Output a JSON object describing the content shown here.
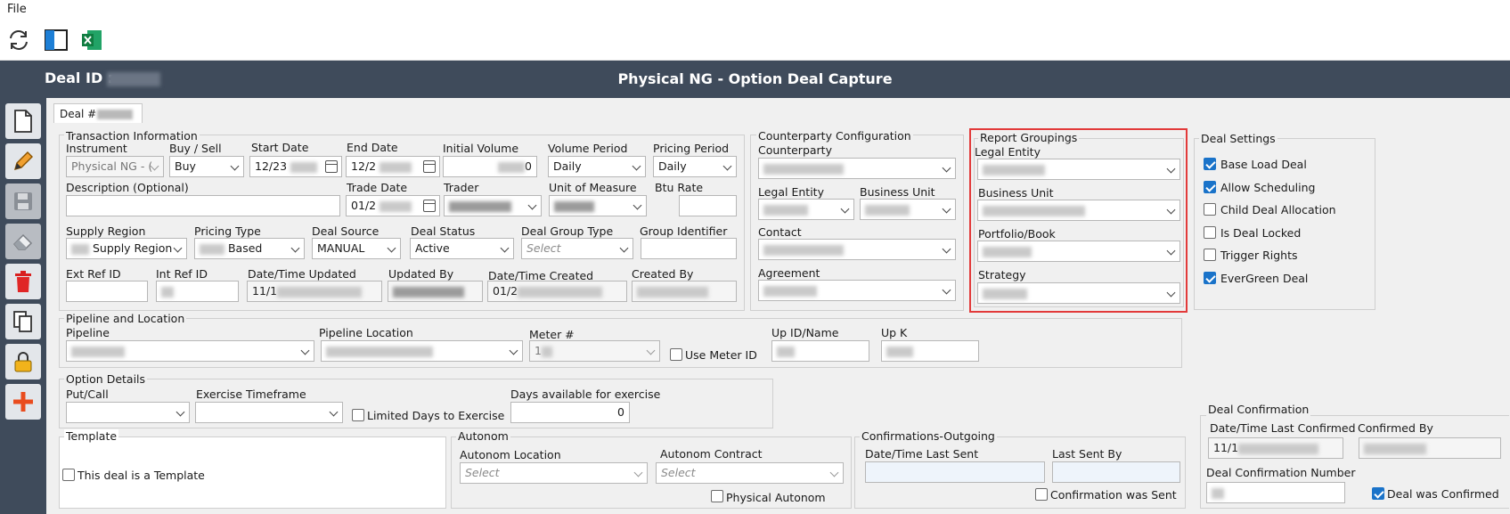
{
  "menu": {
    "file": "File"
  },
  "header": {
    "deal_id_label": "Deal ID :",
    "title": "Physical NG - Option Deal Capture"
  },
  "tab": {
    "label": "Deal #"
  },
  "transaction": {
    "title": "Transaction Information",
    "instrument_label": "Instrument",
    "instrument_value": "Physical NG - (",
    "buy_sell_label": "Buy / Sell",
    "buy_sell_value": "Buy",
    "start_date_label": "Start Date",
    "start_date_value": "12/23",
    "end_date_label": "End Date",
    "end_date_value": "12/2",
    "initial_volume_label": "Initial Volume",
    "initial_volume_value": "0",
    "volume_period_label": "Volume Period",
    "volume_period_value": "Daily",
    "pricing_period_label": "Pricing Period",
    "pricing_period_value": "Daily",
    "description_label": "Description (Optional)",
    "trade_date_label": "Trade Date",
    "trade_date_value": "01/2",
    "trader_label": "Trader",
    "unit_label": "Unit of Measure",
    "btu_label": "Btu Rate",
    "supply_region_label": "Supply Region",
    "supply_region_value": "Supply Region",
    "pricing_type_label": "Pricing Type",
    "pricing_type_value": "Based",
    "deal_source_label": "Deal Source",
    "deal_source_value": "MANUAL",
    "deal_status_label": "Deal Status",
    "deal_status_value": "Active",
    "deal_group_type_label": "Deal Group Type",
    "deal_group_type_placeholder": "Select",
    "group_identifier_label": "Group Identifier",
    "ext_ref_label": "Ext Ref ID",
    "int_ref_label": "Int Ref ID",
    "updated_label": "Date/Time Updated",
    "updated_value": "11/1",
    "updated_by_label": "Updated By",
    "created_label": "Date/Time Created",
    "created_value": "01/2",
    "created_by_label": "Created By"
  },
  "counterparty": {
    "title": "Counterparty Configuration",
    "counterparty_label": "Counterparty",
    "legal_entity_label": "Legal Entity",
    "business_unit_label": "Business Unit",
    "contact_label": "Contact",
    "agreement_label": "Agreement"
  },
  "report_groupings": {
    "title": "Report Groupings",
    "legal_entity_label": "Legal Entity",
    "business_unit_label": "Business Unit",
    "portfolio_label": "Portfolio/Book",
    "strategy_label": "Strategy"
  },
  "deal_settings": {
    "title": "Deal Settings",
    "items": [
      {
        "label": "Base Load Deal",
        "checked": true
      },
      {
        "label": "Allow Scheduling",
        "checked": true
      },
      {
        "label": "Child Deal Allocation",
        "checked": false
      },
      {
        "label": "Is Deal Locked",
        "checked": false
      },
      {
        "label": "Trigger Rights",
        "checked": false
      },
      {
        "label": "EverGreen Deal",
        "checked": true
      }
    ]
  },
  "pipeline": {
    "title": "Pipeline and Location",
    "pipeline_label": "Pipeline",
    "location_label": "Pipeline Location",
    "meter_label": "Meter #",
    "meter_value": "1",
    "use_meter_label": "Use Meter ID",
    "up_id_label": "Up ID/Name",
    "up_k_label": "Up K"
  },
  "option": {
    "title": "Option Details",
    "put_call_label": "Put/Call",
    "exercise_label": "Exercise Timeframe",
    "limited_label": "Limited Days to Exercise",
    "days_label": "Days available for exercise",
    "days_value": "0"
  },
  "template": {
    "title": "Template",
    "checkbox_label": "This deal is a Template"
  },
  "autonom": {
    "title": "Autonom",
    "location_label": "Autonom Location",
    "location_placeholder": "Select",
    "contract_label": "Autonom Contract",
    "contract_placeholder": "Select",
    "physical_label": "Physical Autonom"
  },
  "confirmations": {
    "title": "Confirmations-Outgoing",
    "last_sent_label": "Date/Time Last Sent",
    "last_sent_by_label": "Last Sent By",
    "sent_label": "Confirmation was Sent"
  },
  "deal_confirmation": {
    "title": "Deal Confirmation",
    "last_confirmed_label": "Date/Time Last Confirmed",
    "last_confirmed_value": "11/1",
    "confirmed_by_label": "Confirmed By",
    "number_label": "Deal Confirmation Number",
    "was_confirmed_label": "Deal was Confirmed"
  },
  "colors": {
    "header_bg": "#3f4b5b",
    "highlight": "#e23a3a",
    "check": "#1a73c9"
  },
  "icons": [
    "refresh-icon",
    "layout-icon",
    "excel-icon",
    "new-document-icon",
    "edit-pencil-icon",
    "save-disk-icon",
    "eraser-icon",
    "trash-icon",
    "copy-icon",
    "lock-icon",
    "plus-icon"
  ]
}
